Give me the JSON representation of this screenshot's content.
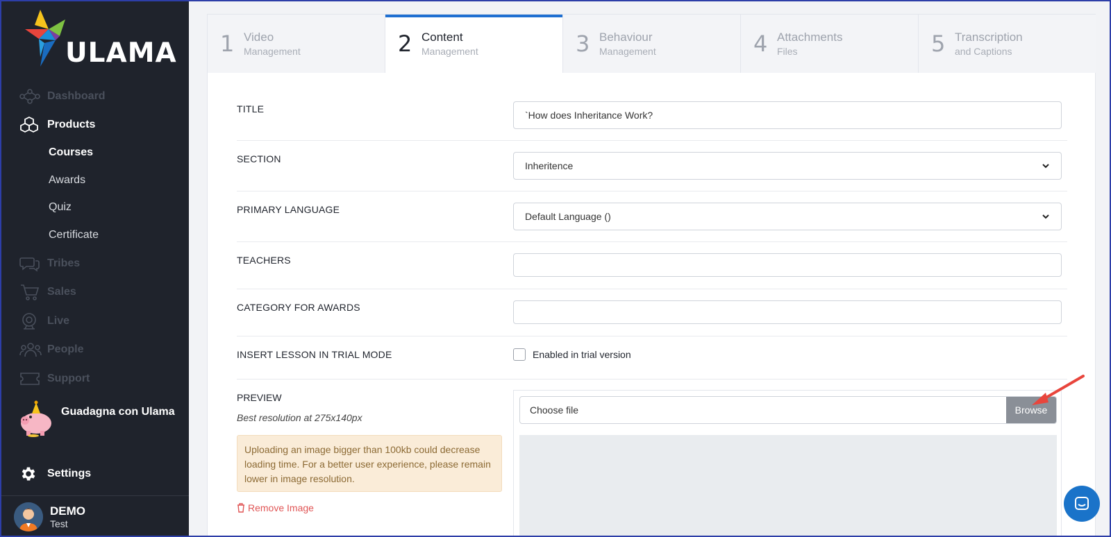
{
  "brand": {
    "name": "ULAMA"
  },
  "sidebar": {
    "items": [
      {
        "label": "Dashboard",
        "icon": "dashboard-icon",
        "state": "dim"
      },
      {
        "label": "Products",
        "icon": "products-icon",
        "state": "active"
      },
      {
        "label": "Tribes",
        "icon": "tribes-icon",
        "state": "dim"
      },
      {
        "label": "Sales",
        "icon": "cart-icon",
        "state": "dim"
      },
      {
        "label": "Live",
        "icon": "webcam-icon",
        "state": "dim"
      },
      {
        "label": "People",
        "icon": "people-icon",
        "state": "dim"
      },
      {
        "label": "Support",
        "icon": "ticket-icon",
        "state": "dim"
      }
    ],
    "subitems": [
      {
        "label": "Courses",
        "state": "active"
      },
      {
        "label": "Awards",
        "state": "normal"
      },
      {
        "label": "Quiz",
        "state": "normal"
      },
      {
        "label": "Certificate",
        "state": "normal"
      }
    ],
    "promo": {
      "label": "Guadagna con Ulama",
      "icon": "piggy-bank-icon"
    },
    "settings": {
      "label": "Settings",
      "icon": "gear-icon"
    },
    "user": {
      "name": "DEMO",
      "sub": "Test"
    }
  },
  "tabs": [
    {
      "num": "1",
      "title": "Video",
      "subtitle": "Management",
      "active": false
    },
    {
      "num": "2",
      "title": "Content",
      "subtitle": "Management",
      "active": true
    },
    {
      "num": "3",
      "title": "Behaviour",
      "subtitle": "Management",
      "active": false
    },
    {
      "num": "4",
      "title": "Attachments",
      "subtitle": "Files",
      "active": false
    },
    {
      "num": "5",
      "title": "Transcription",
      "subtitle": "and Captions",
      "active": false
    }
  ],
  "form": {
    "title_label": "TITLE",
    "title_value": "`How does Inheritance Work?",
    "section_label": "SECTION",
    "section_value": "Inheritence",
    "language_label": "PRIMARY LANGUAGE",
    "language_value": "Default Language ()",
    "teachers_label": "TEACHERS",
    "teachers_value": "",
    "category_label": "CATEGORY FOR AWARDS",
    "category_value": "",
    "trial_label": "INSERT LESSON IN TRIAL MODE",
    "trial_checkbox_label": "Enabled in trial version",
    "trial_checked": false,
    "preview_label": "PREVIEW",
    "preview_hint": "Best resolution at 275x140px",
    "preview_warning": "Uploading an image bigger than 100kb could decrease loading time. For a better user experience, please remain lower in image resolution.",
    "remove_image": "Remove Image",
    "file_placeholder": "Choose file",
    "browse_label": "Browse"
  },
  "colors": {
    "sidebar_bg": "#1f232c",
    "accent": "#1f6fd1",
    "warning_bg": "#faecd8",
    "danger": "#e05656",
    "annotation_arrow": "#e8453c",
    "chat_button": "#1a73c9"
  }
}
